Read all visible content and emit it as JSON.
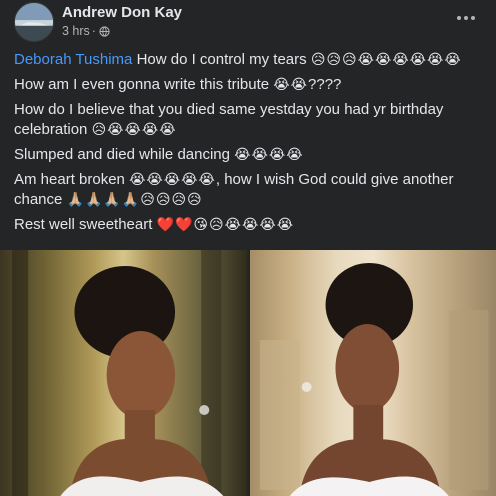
{
  "post": {
    "author": "Andrew Don Kay",
    "time": "3 hrs",
    "separator": "·",
    "more_label": "More options"
  },
  "body": {
    "line1_mention": "Deborah Tushima",
    "line1_text": " How do I control my tears ",
    "line1_emoji": "😥😥😥😭😭😭😭😭😭",
    "line2_text": "How am I even gonna write this tribute ",
    "line2_emoji": "😭😭",
    "line2_tail": "????",
    "line3_text": "How do I believe that you died same yestday you had yr birthday celebration ",
    "line3_emoji": "😥😭😭😭😭",
    "line4_text": "Slumped and died while dancing ",
    "line4_emoji": "😭😭😭😭",
    "line5_text": "Am heart broken ",
    "line5_emoji": "😭😭😭😭😭",
    "line5_text2": ", how I wish God could give another chance ",
    "line5_emoji2": "🙏🏼🙏🏼🙏🏼🙏🏼😥😥😥😥",
    "line6_text": "Rest well sweetheart ",
    "line6_emoji": "❤️❤️😘😥😭😭😭😭"
  },
  "photos": [
    {
      "name": "portrait-left"
    },
    {
      "name": "portrait-right"
    }
  ]
}
